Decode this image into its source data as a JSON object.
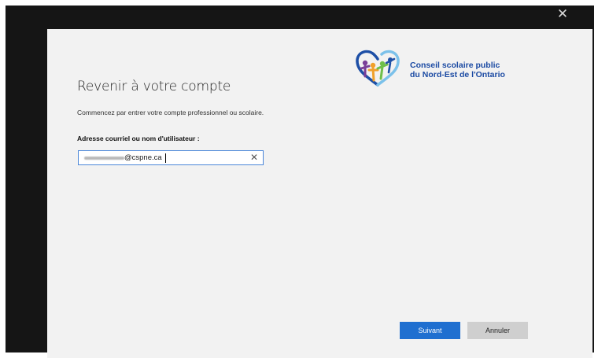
{
  "window": {
    "close_glyph": "✕"
  },
  "logo": {
    "icon": "heart-logo-icon",
    "line1": "Conseil scolaire public",
    "line2": "du Nord-Est de l'Ontario"
  },
  "form": {
    "title": "Revenir à votre compte",
    "subtitle": "Commencez par entrer votre compte professionnel ou scolaire.",
    "field_label": "Adresse courriel ou nom d'utilisateur :",
    "input_value": "@cspne.ca",
    "clear_glyph": "✕"
  },
  "buttons": {
    "next": "Suivant",
    "cancel": "Annuler"
  },
  "colors": {
    "frame": "#151515",
    "dialog": "#f2f2f2",
    "primary_button": "#1f6fd0",
    "secondary_button": "#cfcfcf",
    "brand_text": "#1b4aa3"
  }
}
